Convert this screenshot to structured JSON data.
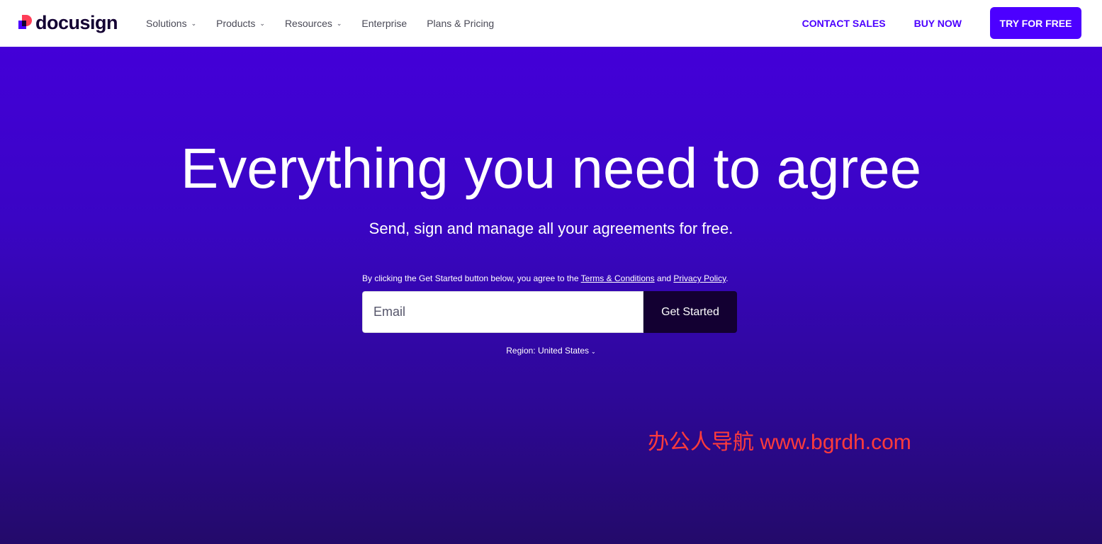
{
  "brand": {
    "name": "docusign",
    "colors": {
      "primary": "#4c00ff",
      "dark": "#130032",
      "logo_red": "#ff3d57"
    }
  },
  "nav": {
    "items": [
      {
        "label": "Solutions",
        "has_dropdown": true
      },
      {
        "label": "Products",
        "has_dropdown": true
      },
      {
        "label": "Resources",
        "has_dropdown": true
      },
      {
        "label": "Enterprise",
        "has_dropdown": false
      },
      {
        "label": "Plans & Pricing",
        "has_dropdown": false
      }
    ],
    "contact_sales": "CONTACT SALES",
    "buy_now": "BUY NOW",
    "try_for_free": "TRY FOR FREE",
    "chevron_icon": "chevron-down-icon"
  },
  "hero": {
    "title": "Everything you need to agree",
    "subtitle": "Send, sign and manage all your agreements for free.",
    "consent": {
      "prefix": "By clicking the Get Started button below, you agree to the ",
      "terms_link": "Terms & Conditions",
      "middle": " and ",
      "privacy_link": "Privacy Policy",
      "suffix": "."
    },
    "email_placeholder": "Email",
    "get_started": "Get Started",
    "region": "Region: United States"
  },
  "watermark": "办公人导航 www.bgrdh.com"
}
